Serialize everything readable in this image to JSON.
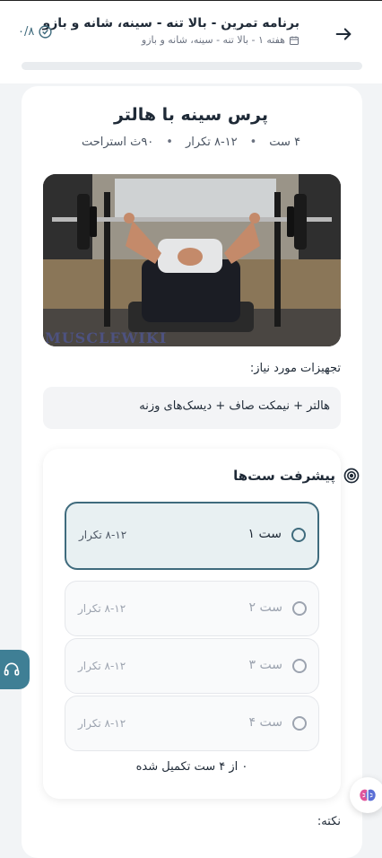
{
  "header": {
    "title": "برنامه تمرین - بالا تنه - سینه، شانه و بازو",
    "subtitle": "هفته ۱ - بالا تنه - سینه، شانه و بازو",
    "counter": "۰/۸",
    "progress": 0.0,
    "icons": {
      "back": "arrow-right-icon",
      "calendar": "calendar-icon",
      "check": "check-circle-icon"
    }
  },
  "exercise": {
    "title": "پرس سینه با هالتر",
    "sets": "۴ ست",
    "reps": "۸-۱۲ تکرار",
    "rest": "۹۰ث استراحت",
    "watermark": "MUSCLEWIKI"
  },
  "equipment": {
    "label": "تجهیزات مورد نیاز:",
    "value": "هالتر + نیمکت صاف + دیسک‌های وزنه"
  },
  "sets_progress": {
    "heading": "پیشرفت ست‌ها",
    "items": [
      {
        "name": "ست ۱",
        "reps": "۸-۱۲ تکرار"
      },
      {
        "name": "ست ۲",
        "reps": "۸-۱۲ تکرار"
      },
      {
        "name": "ست ۳",
        "reps": "۸-۱۲ تکرار"
      },
      {
        "name": "ست ۴",
        "reps": "۸-۱۲ تکرار"
      }
    ],
    "status": "۰ از ۴ ست تکمیل شده"
  },
  "note": {
    "label": "نکته:"
  },
  "colors": {
    "accent": "#3f6b7d",
    "side_tab": "#3f7f95"
  }
}
